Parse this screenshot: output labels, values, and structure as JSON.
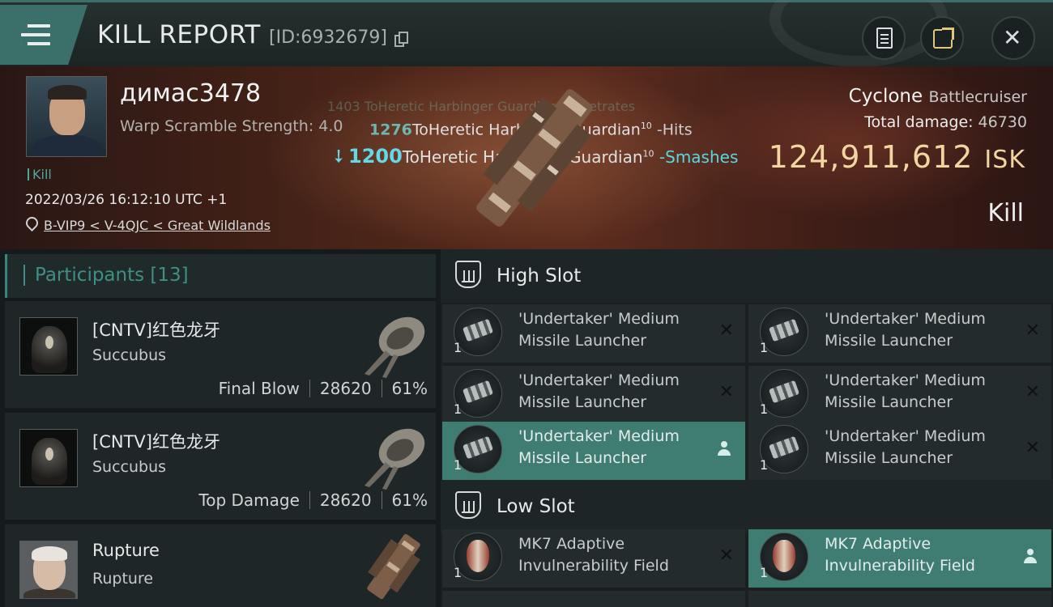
{
  "header": {
    "title": "KILL REPORT",
    "report_id": "[ID:6932679]"
  },
  "victim": {
    "name": "димас3478",
    "warp_label": "Warp Scramble Strength: 4.0",
    "kill_tag": "Kill",
    "datetime": "2022/03/26 16:12:10 UTC +1",
    "location": "B-VIP9 < V-4QJC < Great Wildlands",
    "ship_name": "Cyclone",
    "ship_class": "Battlecruiser",
    "total_damage_label": "Total damage:",
    "total_damage": "46730",
    "isk_value": "124,911,612",
    "isk_unit": "ISK",
    "result": "Kill"
  },
  "hits": {
    "ghost": "1403  ToHeretic Harbinger Guardian   -Penetrates",
    "row1": {
      "num": "1276",
      "text": "ToHeretic Harbinger Guardian",
      "sup": "10",
      "verb": " -Hits"
    },
    "row2": {
      "num": "1200",
      "text": "ToHeretic Harbinger Guardian",
      "sup": "10",
      "verb": " -Smashes"
    }
  },
  "participants": {
    "label": "Participants [13]",
    "rows": [
      {
        "name": "[CNTV]红色龙牙",
        "ship": "Succubus",
        "role": "Final Blow",
        "damage": "28620",
        "percent": "61%"
      },
      {
        "name": "[CNTV]红色龙牙",
        "ship": "Succubus",
        "role": "Top Damage",
        "damage": "28620",
        "percent": "61%"
      },
      {
        "name": "Rupture",
        "ship": "Rupture"
      }
    ]
  },
  "slots": {
    "high_title": "High Slot",
    "low_title": "Low Slot",
    "high": [
      {
        "line1": "'Undertaker' Medium",
        "line2": "Missile Launcher",
        "qty": "1"
      },
      {
        "line1": "'Undertaker' Medium",
        "line2": "Missile Launcher",
        "qty": "1"
      },
      {
        "line1": "'Undertaker' Medium",
        "line2": "Missile Launcher",
        "qty": "1"
      },
      {
        "line1": "'Undertaker' Medium",
        "line2": "Missile Launcher",
        "qty": "1"
      },
      {
        "line1": "'Undertaker' Medium",
        "line2": "Missile Launcher",
        "qty": "1"
      },
      {
        "line1": "'Undertaker' Medium",
        "line2": "Missile Launcher",
        "qty": "1"
      }
    ],
    "low": [
      {
        "line1": "MK7 Adaptive",
        "line2": "Invulnerability Field",
        "qty": "1"
      },
      {
        "line1": "MK7 Adaptive",
        "line2": "Invulnerability Field",
        "qty": "1"
      }
    ]
  },
  "colors": {
    "accent_teal": "#3b6f69",
    "isk_gold": "#f1d6a1",
    "hit_cyan": "#64d8e4",
    "active_module": "#3f7d73"
  },
  "icons": [
    "menu-icon",
    "copy-icon",
    "clipboard-icon",
    "share-icon",
    "close-icon",
    "location-pin-icon",
    "damage-arrow-icon",
    "slot-shield-icon",
    "remove-x-icon",
    "user-icon"
  ]
}
